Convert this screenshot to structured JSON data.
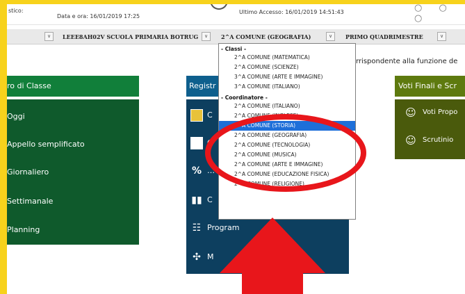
{
  "topbar": {
    "left_label": "stico:",
    "date": "Data e ora: 16/01/2019 17:25",
    "last_access": "Ultimo Accesso: 16/01/2019 14:51:43"
  },
  "selectors": {
    "school": "LEEE8AH02V SCUOLA PRIMARIA BOTRUG",
    "class_subject": "2^A COMUNE (GEOGRAFIA)",
    "period": "PRIMO QUADRIMESTRE"
  },
  "dropdown": {
    "group1_label": "- Classi -",
    "group1_options": [
      "2^A COMUNE (MATEMATICA)",
      "2^A COMUNE (SCIENZE)",
      "3^A COMUNE (ARTE E IMMAGINE)",
      "3^A COMUNE (ITALIANO)"
    ],
    "group2_label": "- Coordinatore -",
    "group2_options": [
      "2^A COMUNE (ITALIANO)",
      "2^A COMUNE (INGLESE)",
      "2^A COMUNE (STORIA)",
      "2^A COMUNE (GEOGRAFIA)",
      "2^A COMUNE (TECNOLOGIA)",
      "2^A COMUNE (MUSICA)",
      "2^A COMUNE (ARTE E IMMAGINE)",
      "2^A COMUNE (EDUCAZIONE FISICA)",
      "2^A COMUNE (RELIGIONE)"
    ],
    "selected": "2^A COMUNE (STORIA)"
  },
  "notice": "rrispondente alla funzione de",
  "panels": {
    "green": {
      "header": "ro di Classe",
      "items": [
        "Oggi",
        "Appello semplificato",
        "Giornaliero",
        "Settimanale",
        "Planning"
      ]
    },
    "blue": {
      "header": "Registr",
      "items": [
        "C",
        "C",
        "…",
        "C",
        "Program",
        "M"
      ]
    },
    "olive": {
      "header": "Voti Finali e Scr",
      "items": [
        "Voti Propo",
        "Scrutinio"
      ]
    }
  },
  "colors": {
    "frame": "#f7d21c",
    "green_header": "#117f3a",
    "green_body": "#0f5a2c",
    "blue_header": "#0e5f8d",
    "blue_body": "#0d3f5f",
    "olive_header": "#5e7a0f",
    "olive_body": "#4a5a0c",
    "highlight": "#1e6fd9",
    "annotation": "#e8161b"
  }
}
